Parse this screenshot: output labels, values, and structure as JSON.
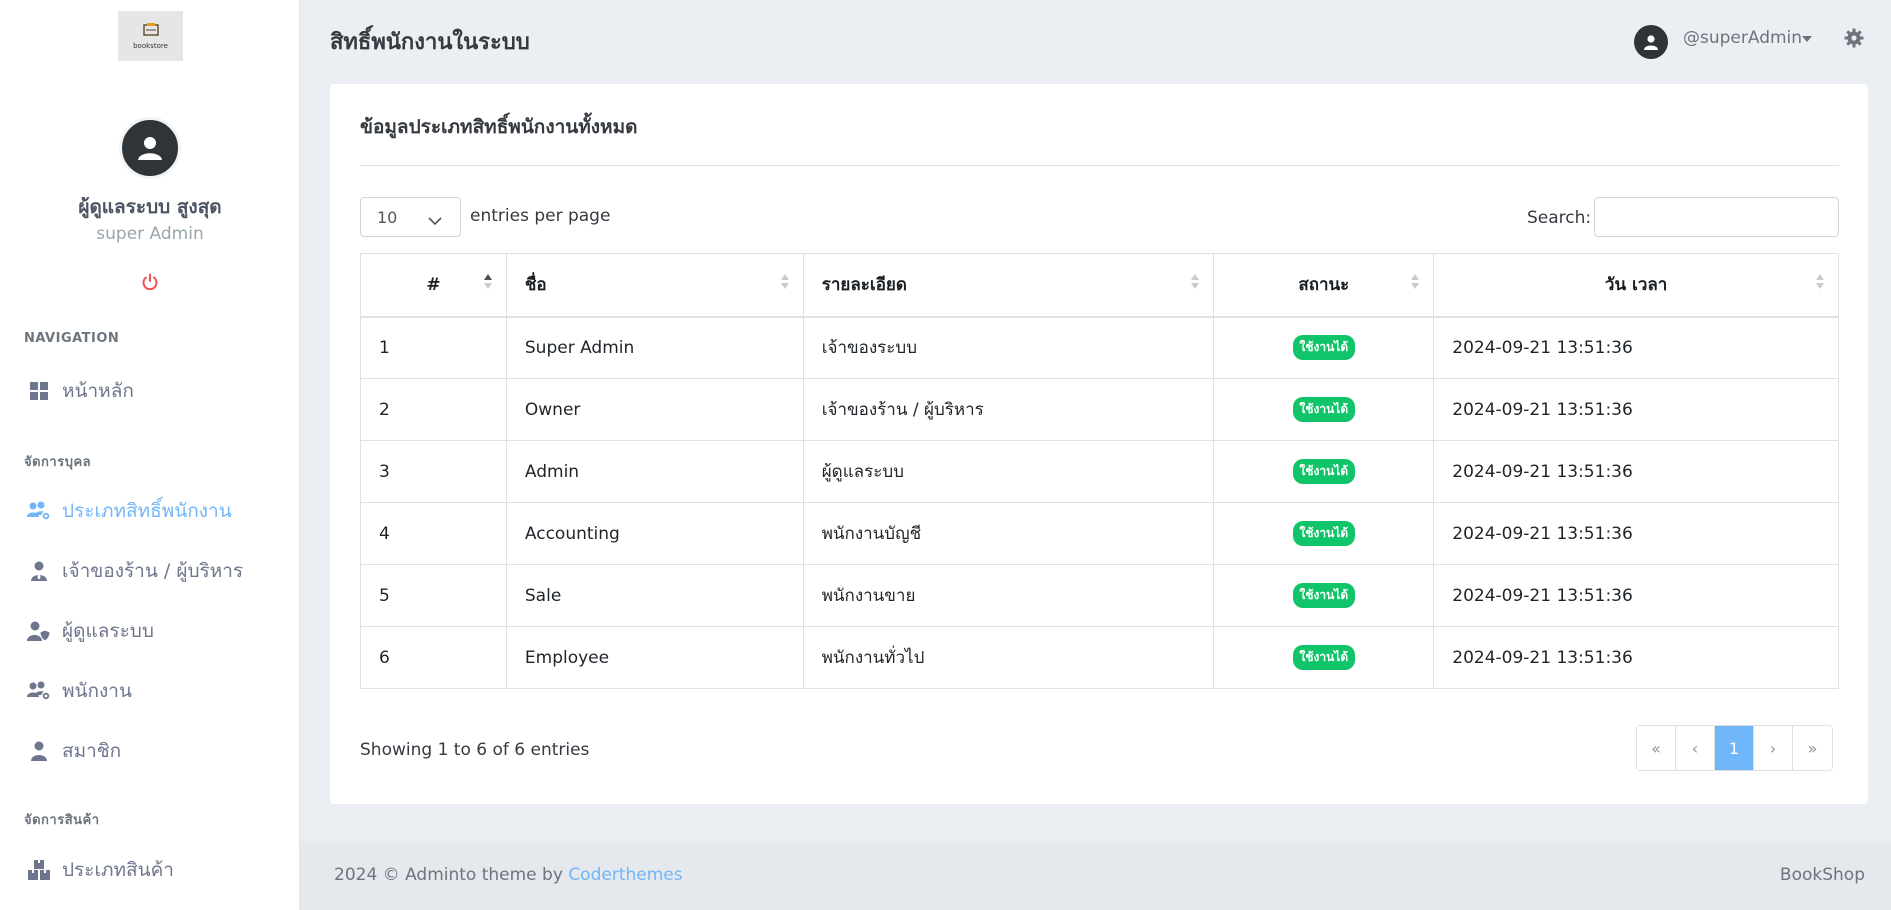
{
  "sidebar": {
    "logo_text": "bookstore",
    "user_name": "ผู้ดูแลระบบ สูงสุด",
    "user_role": "super Admin",
    "sections": {
      "navigation": "NAVIGATION",
      "people": "จัดการบุคล",
      "products": "จัดการสินค้า"
    },
    "items": [
      {
        "label": "หน้าหลัก",
        "icon": "dashboard-icon"
      },
      {
        "label": "ประเภทสิทธิ์พนักงาน",
        "icon": "users-cog-icon",
        "active": true
      },
      {
        "label": "เจ้าของร้าน / ผู้บริหาร",
        "icon": "user-tie-icon"
      },
      {
        "label": "ผู้ดูแลระบบ",
        "icon": "user-shield-icon"
      },
      {
        "label": "พนักงาน",
        "icon": "users-gear-icon"
      },
      {
        "label": "สมาชิก",
        "icon": "user-icon"
      },
      {
        "label": "ประเภทสินค้า",
        "icon": "boxes-icon"
      }
    ]
  },
  "header": {
    "title": "สิทธิ์พนักงานในระบบ",
    "username": "@superAdmin"
  },
  "card": {
    "title": "ข้อมูลประเภทสิทธิ์พนักงานทั้งหมด",
    "entries_value": "10",
    "entries_label": "entries per page",
    "search_label": "Search:",
    "search_value": ""
  },
  "table": {
    "columns": [
      "#",
      "ชื่อ",
      "รายละเอียด",
      "สถานะ",
      "วัน เวลา"
    ],
    "rows": [
      {
        "id": "1",
        "name": "Super Admin",
        "detail": "เจ้าของระบบ",
        "status": "ใช้งานได้",
        "datetime": "2024-09-21 13:51:36"
      },
      {
        "id": "2",
        "name": "Owner",
        "detail": "เจ้าของร้าน / ผู้บริหาร",
        "status": "ใช้งานได้",
        "datetime": "2024-09-21 13:51:36"
      },
      {
        "id": "3",
        "name": "Admin",
        "detail": "ผู้ดูแลระบบ",
        "status": "ใช้งานได้",
        "datetime": "2024-09-21 13:51:36"
      },
      {
        "id": "4",
        "name": "Accounting",
        "detail": "พนักงานบัญชี",
        "status": "ใช้งานได้",
        "datetime": "2024-09-21 13:51:36"
      },
      {
        "id": "5",
        "name": "Sale",
        "detail": "พนักงานขาย",
        "status": "ใช้งานได้",
        "datetime": "2024-09-21 13:51:36"
      },
      {
        "id": "6",
        "name": "Employee",
        "detail": "พนักงานทั่วไป",
        "status": "ใช้งานได้",
        "datetime": "2024-09-21 13:51:36"
      }
    ],
    "info": "Showing 1 to 6 of 6 entries"
  },
  "pagination": {
    "first": "«",
    "prev": "‹",
    "current": "1",
    "next": "›",
    "last": "»"
  },
  "footer": {
    "text": "2024 © Adminto theme by ",
    "link": "Coderthemes",
    "right": "BookShop"
  },
  "colors": {
    "accent": "#71b6f9",
    "success": "#10c469",
    "danger": "#f05050"
  }
}
